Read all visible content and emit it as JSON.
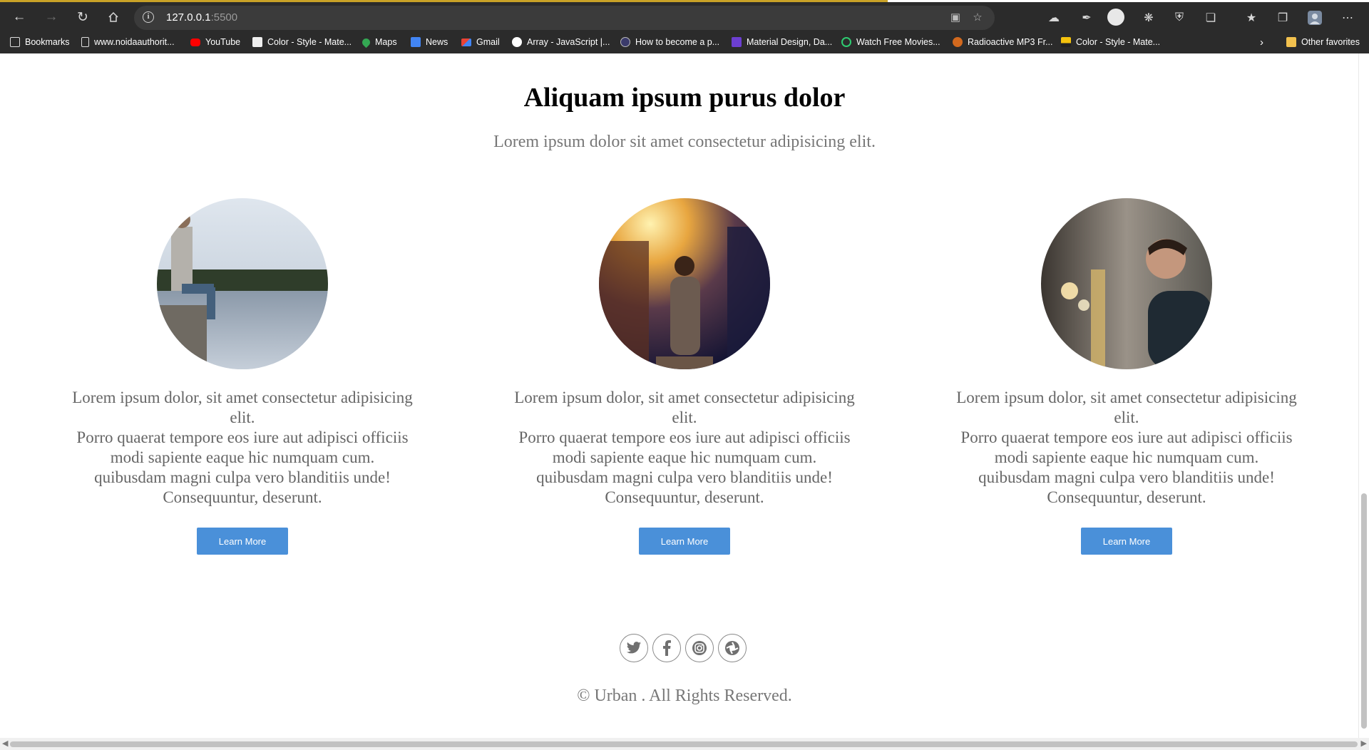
{
  "browser": {
    "url_host": "127.0.0.1",
    "url_port": ":5500",
    "bookmarks": [
      {
        "label": "Bookmarks",
        "icon": "bookmarks-bar-icon",
        "color": "#ffffff"
      },
      {
        "label": "www.noidaauthorit...",
        "icon": "page-icon",
        "color": "#ffffff"
      },
      {
        "label": "YouTube",
        "icon": "youtube-icon",
        "color": "#ff0000"
      },
      {
        "label": "Color - Style - Mate...",
        "icon": "material-icon",
        "color": "#ffffff"
      },
      {
        "label": "Maps",
        "icon": "maps-icon",
        "color": "#34a853"
      },
      {
        "label": "News",
        "icon": "news-icon",
        "color": "#4285f4"
      },
      {
        "label": "Gmail",
        "icon": "gmail-icon",
        "color": "#ea4335"
      },
      {
        "label": "Array - JavaScript |...",
        "icon": "mdn-icon",
        "color": "#ffffff"
      },
      {
        "label": "How to become a p...",
        "icon": "circle-a-icon",
        "color": "#3b3b6b"
      },
      {
        "label": "Material Design, Da...",
        "icon": "up-icon",
        "color": "#6c3fd1"
      },
      {
        "label": "Watch Free Movies...",
        "icon": "play-icon",
        "color": "#2ecc71"
      },
      {
        "label": "Radioactive MP3 Fr...",
        "icon": "paw-icon",
        "color": "#d2691e"
      },
      {
        "label": "Color - Style - Mate...",
        "icon": "flag-icon",
        "color": "#f4c20d"
      }
    ],
    "other_favorites": "Other favorites"
  },
  "section": {
    "title": "Aliquam ipsum purus dolor",
    "subtitle": "Lorem ipsum dolor sit amet consectetur adipisicing elit."
  },
  "cards": [
    {
      "image": "man-sitting-on-dock-by-lake",
      "lines": [
        "Lorem ipsum dolor, sit amet consectetur adipisicing elit.",
        "Porro quaerat tempore eos iure aut adipisci officiis modi sapiente eaque hic numquam cum.",
        "quibusdam magni culpa vero blanditiis unde! Consequuntur, deserunt."
      ],
      "button": "Learn More"
    },
    {
      "image": "woman-overlooking-canyon-at-sunset",
      "lines": [
        "Lorem ipsum dolor, sit amet consectetur adipisicing elit.",
        "Porro quaerat tempore eos iure aut adipisci officiis modi sapiente eaque hic numquam cum.",
        "quibusdam magni culpa vero blanditiis unde! Consequuntur, deserunt."
      ],
      "button": "Learn More"
    },
    {
      "image": "man-on-subway-platform",
      "lines": [
        "Lorem ipsum dolor, sit amet consectetur adipisicing elit.",
        "Porro quaerat tempore eos iure aut adipisci officiis modi sapiente eaque hic numquam cum.",
        "quibusdam magni culpa vero blanditiis unde! Consequuntur, deserunt."
      ],
      "button": "Learn More"
    }
  ],
  "footer": {
    "socials": [
      "twitter-icon",
      "facebook-icon",
      "instagram-icon",
      "picasa-icon"
    ],
    "copyright": "© Urban . All Rights Reserved."
  },
  "colors": {
    "button": "#4a90d9",
    "muted_text": "#777777",
    "chrome": "#2b2b2b"
  }
}
